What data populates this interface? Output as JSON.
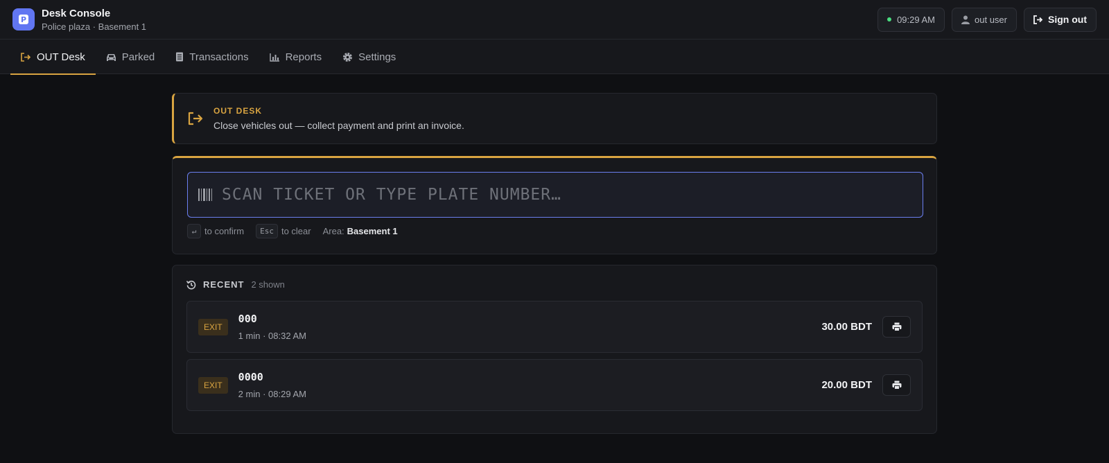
{
  "header": {
    "title": "Desk Console",
    "subtitle": "Police plaza · Basement 1",
    "time": "09:29 AM",
    "user": "out user",
    "signout_label": "Sign out"
  },
  "tabs": [
    {
      "label": "OUT Desk",
      "icon": "sign-out-icon",
      "active": true
    },
    {
      "label": "Parked",
      "icon": "car-icon"
    },
    {
      "label": "Transactions",
      "icon": "receipt-icon"
    },
    {
      "label": "Reports",
      "icon": "bar-chart-icon"
    },
    {
      "label": "Settings",
      "icon": "gear-icon"
    }
  ],
  "banner": {
    "label": "OUT DESK",
    "text": "Close vehicles out — collect payment and print an invoice."
  },
  "scan": {
    "placeholder": "SCAN TICKET OR TYPE PLATE NUMBER…",
    "enter_key": "↵",
    "enter_hint": "to confirm",
    "esc_key": "Esc",
    "esc_hint": "to clear",
    "area_label": "Area:",
    "area_value": "Basement 1"
  },
  "recent": {
    "title": "RECENT",
    "count": "2 shown",
    "items": [
      {
        "badge": "EXIT",
        "plate": "000",
        "meta": "1 min · 08:32 AM",
        "amount": "30.00 BDT"
      },
      {
        "badge": "EXIT",
        "plate": "0000",
        "meta": "2 min · 08:29 AM",
        "amount": "20.00 BDT"
      }
    ]
  },
  "colors": {
    "accent": "#d9a441",
    "brand": "#6176f2",
    "online": "#4ade80"
  }
}
